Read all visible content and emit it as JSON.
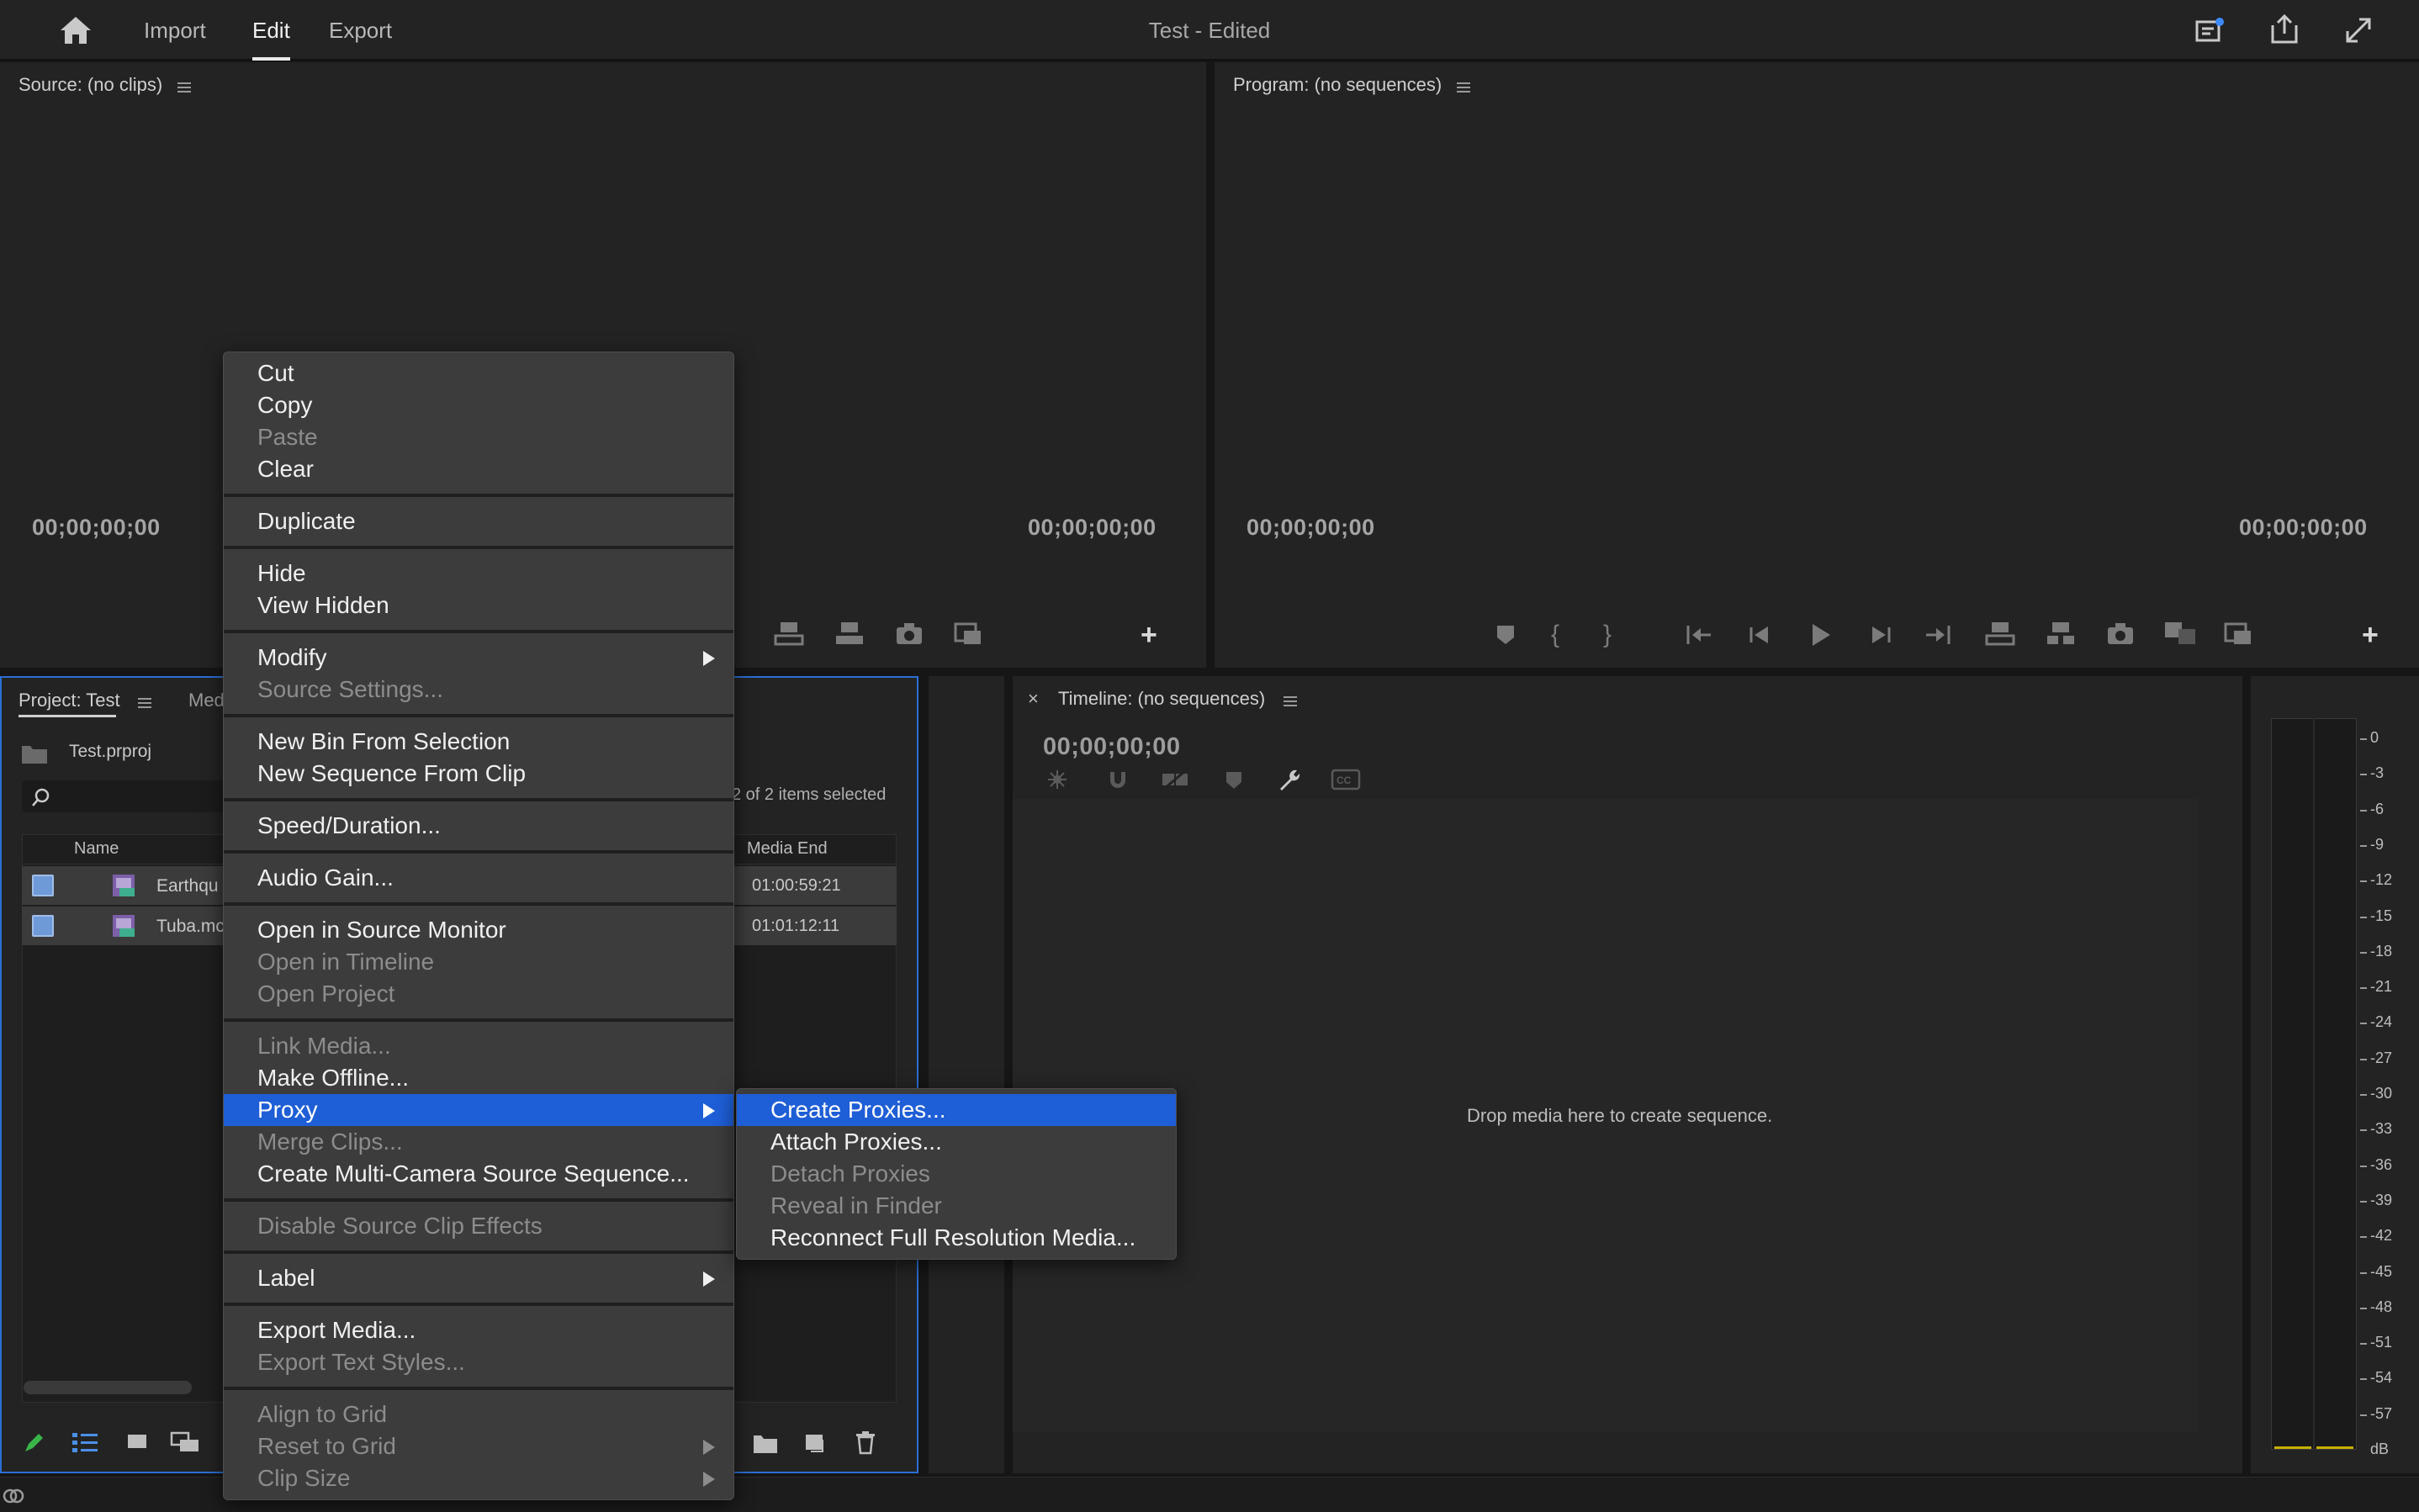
{
  "topbar": {
    "tabs": [
      {
        "label": "Import",
        "active": false
      },
      {
        "label": "Edit",
        "active": true
      },
      {
        "label": "Export",
        "active": false
      }
    ],
    "title": "Test - Edited"
  },
  "source_monitor": {
    "title": "Source: (no clips)",
    "timecode_in": "00;00;00;00",
    "timecode_out": "00;00;00;00"
  },
  "program_monitor": {
    "title": "Program: (no sequences)",
    "timecode_in": "00;00;00;00",
    "timecode_out": "00;00;00;00"
  },
  "project": {
    "title": "Project: Test",
    "second_tab": "Med",
    "file": "Test.prproj",
    "items_selected": "2 of 2 items selected",
    "columns": {
      "name": "Name",
      "media_end": "Media End"
    },
    "rows": [
      {
        "name": "Earthqu",
        "media_end": "01:00:59:21"
      },
      {
        "name": "Tuba.mc",
        "media_end": "01:01:12:11"
      }
    ]
  },
  "timeline": {
    "title": "Timeline: (no sequences)",
    "timecode": "00;00;00;00",
    "drop_text": "Drop media here to create sequence."
  },
  "audio_meter": {
    "scale": [
      "0",
      "-3",
      "-6",
      "-9",
      "-12",
      "-15",
      "-18",
      "-21",
      "-24",
      "-27",
      "-30",
      "-33",
      "-36",
      "-39",
      "-42",
      "-45",
      "-48",
      "-51",
      "-54",
      "-57",
      "dB"
    ]
  },
  "context_menu": {
    "items": [
      "Cut",
      "Copy",
      "Paste",
      "Clear",
      "Duplicate",
      "Hide",
      "View Hidden",
      "Modify",
      "Source Settings...",
      "New Bin From Selection",
      "New Sequence From Clip",
      "Speed/Duration...",
      "Audio Gain...",
      "Open in Source Monitor",
      "Open in Timeline",
      "Open Project",
      "Link Media...",
      "Make Offline...",
      "Proxy",
      "Merge Clips...",
      "Create Multi-Camera Source Sequence...",
      "Disable Source Clip Effects",
      "Label",
      "Export Media...",
      "Export Text Styles...",
      "Align to Grid",
      "Reset to Grid",
      "Clip Size"
    ]
  },
  "proxy_submenu": {
    "items": [
      "Create Proxies...",
      "Attach Proxies...",
      "Detach Proxies",
      "Reveal in Finder",
      "Reconnect Full Resolution Media..."
    ]
  },
  "colors": {
    "accent": "#1e5ed6",
    "panel": "#232323",
    "menu": "#3c3c3c"
  }
}
